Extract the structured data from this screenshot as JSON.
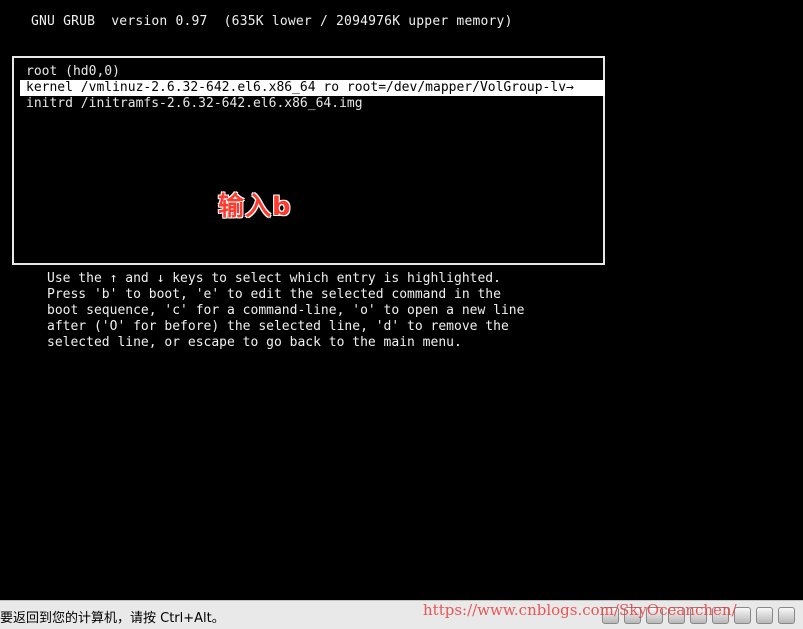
{
  "header": {
    "text": "GNU GRUB  version 0.97  (635K lower / 2094976K upper memory)"
  },
  "menu": {
    "entries": [
      "root (hd0,0)",
      "kernel /vmlinuz-2.6.32-642.el6.x86_64 ro root=/dev/mapper/VolGroup-lv→",
      "initrd /initramfs-2.6.32-642.el6.x86_64.img"
    ],
    "selected_index": 1
  },
  "overlay": {
    "text": "输入b",
    "color": "#ff3b30"
  },
  "help": {
    "lines": [
      "Use the ↑ and ↓ keys to select which entry is highlighted.",
      "Press 'b' to boot, 'e' to edit the selected command in the",
      "boot sequence, 'c' for a command-line, 'o' to open a new line",
      "after ('O' for before) the selected line, 'd' to remove the",
      "selected line, or escape to go back to the main menu."
    ]
  },
  "taskbar": {
    "message": "要返回到您的计算机，请按 Ctrl+Alt。",
    "tray_icons": [
      "hdd-icon",
      "cdrom-icon",
      "floppy-icon",
      "network-icon",
      "display-icon",
      "sound-icon",
      "usb-icon",
      "vm-icon",
      "settings-icon"
    ]
  },
  "watermark": {
    "text": "https://www.cnblogs.com/SkyOceanchen/"
  }
}
